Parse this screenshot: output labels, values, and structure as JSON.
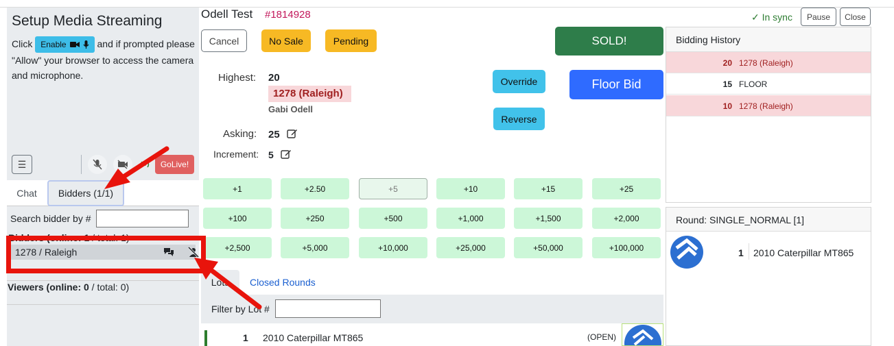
{
  "stream": {
    "title": "Setup Media Streaming",
    "text_before": "Click",
    "enable_label": "Enable",
    "text_after": "and if prompted please \"Allow\" your browser to access the camera and microphone.",
    "golive_label": "GoLive!"
  },
  "left_tabs": {
    "chat": "Chat",
    "bidders": "Bidders (1/1)"
  },
  "bidders": {
    "search_label": "Search bidder by #",
    "search_value": "",
    "heading_bold": "Bidders (online: 1",
    "heading_rest": " / total: 1)",
    "rows": [
      {
        "name": "1278 / Raleigh"
      }
    ],
    "viewers_prefix": "Viewers (",
    "viewers_bold": "online: 0",
    "viewers_rest": " / total: 0)"
  },
  "lot": {
    "title": "Odell Test",
    "number": "#1814928"
  },
  "actions": {
    "cancel": "Cancel",
    "no_sale": "No Sale",
    "pending": "Pending",
    "sold": "SOLD!",
    "override": "Override",
    "reverse": "Reverse",
    "floor_bid": "Floor Bid"
  },
  "bid_info": {
    "highest_label": "Highest:",
    "highest_value": "20",
    "highest_bidder": "1278 (Raleigh)",
    "highest_name": "Gabi Odell",
    "asking_label": "Asking:",
    "asking_value": "25",
    "increment_label": "Increment:",
    "increment_value": "5"
  },
  "increments": [
    [
      "+1",
      "+2.50",
      "+5",
      "+10",
      "+15",
      "+25"
    ],
    [
      "+100",
      "+250",
      "+500",
      "+1,000",
      "+1,500",
      "+2,000"
    ],
    [
      "+2,500",
      "+5,000",
      "+10,000",
      "+25,000",
      "+50,000",
      "+100,000"
    ]
  ],
  "lots_tabs": {
    "lots": "Lots",
    "closed": "Closed Rounds"
  },
  "filter": {
    "label": "Filter by Lot #",
    "value": ""
  },
  "lots": [
    {
      "num": "1",
      "desc": "2010 Caterpillar MT865",
      "status": "(OPEN)"
    }
  ],
  "sync": {
    "status": "✓ In sync",
    "pause": "Pause",
    "close": "Close"
  },
  "history": {
    "title": "Bidding History",
    "rows": [
      {
        "amount": "20",
        "who": "1278 (Raleigh)",
        "highlight": true
      },
      {
        "amount": "15",
        "who": "FLOOR",
        "highlight": false
      },
      {
        "amount": "10",
        "who": "1278 (Raleigh)",
        "highlight": true
      }
    ]
  },
  "round": {
    "title": "Round: SINGLE_NORMAL [1]",
    "items": [
      {
        "num": "1",
        "desc": "2010 Caterpillar MT865"
      }
    ]
  },
  "colors": {
    "sold": "#2e7d4a",
    "floor_bid": "#2f6bff",
    "cyan": "#41c2ea",
    "amber": "#f7b924",
    "increment": "#ccf7d8",
    "highlight": "#f8d7da",
    "annotation": "#e8140c"
  }
}
